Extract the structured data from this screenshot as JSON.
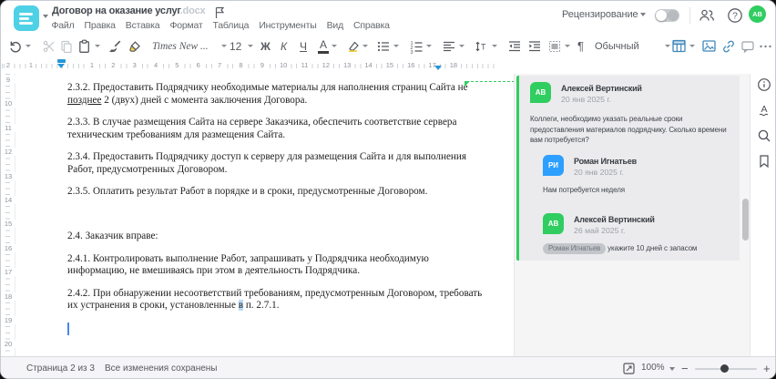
{
  "window": {
    "title": "Договор на оказание услуг",
    "title_ext": ".docx",
    "menus": [
      "Файл",
      "Правка",
      "Вставка",
      "Формат",
      "Таблица",
      "Инструменты",
      "Вид",
      "Справка"
    ],
    "review_label": "Рецензирование",
    "avatar_initials": "АВ"
  },
  "toolbar": {
    "font_name": "Times New ...",
    "font_size": "12",
    "bold_label": "Ж",
    "italic_label": "К",
    "underline_label": "Ч",
    "font_color_label": "А",
    "paragraph_mark": "¶",
    "style_name": "Обычный"
  },
  "ruler": {
    "h_left_numbers": [
      "2",
      "1"
    ],
    "h_numbers": [
      "1",
      "2",
      "3",
      "4",
      "5",
      "6",
      "7",
      "8",
      "9",
      "10",
      "11",
      "12",
      "13",
      "14",
      "15",
      "16",
      "17",
      "18"
    ],
    "v_numbers": [
      "9",
      "10",
      "11",
      "12",
      "13",
      "14",
      "15",
      "16",
      "17",
      "18",
      "19",
      "20"
    ]
  },
  "document": {
    "paragraphs": [
      {
        "runs": [
          {
            "t": "2.3.2. Предоставить Подрядчику необходимые материалы для наполнения страниц Сайта не\n"
          },
          {
            "t": "позднее",
            "u": true
          },
          {
            "t": " 2 (двух) дней с момента заключения Договора."
          }
        ]
      },
      {
        "runs": [
          {
            "t": "2.3.3. В случае размещения Сайта на сервере Заказчика, обеспечить соответствие сервера\nтехническим требованиям для размещения Сайта."
          }
        ]
      },
      {
        "runs": [
          {
            "t": "2.3.4. Предоставить Подрядчику доступ к серверу для размещения Сайта и для выполнения\nРабот, предусмотренных Договором."
          }
        ]
      },
      {
        "runs": [
          {
            "t": "2.3.5. Оплатить результат Работ в порядке и в сроки, предусмотренные Договором."
          }
        ]
      },
      {
        "empty": true,
        "runs": []
      },
      {
        "runs": [
          {
            "t": "2.4. Заказчик вправе:"
          }
        ]
      },
      {
        "runs": [
          {
            "t": "2.4.1. Контролировать выполнение Работ, запрашивать у Подрядчика необходимую\nинформацию, не вмешиваясь при этом в деятельность Подрядчика."
          }
        ]
      },
      {
        "runs": [
          {
            "t": "2.4.2. При обнаружении несоответствий требованиям, предусмотренным Договором, требовать\nих устранения в сроки, установленные "
          },
          {
            "t": "в",
            "hl": true
          },
          {
            "t": " п. 2.7.1."
          }
        ]
      }
    ]
  },
  "comments": [
    {
      "initials": "АВ",
      "color": "#30cd61",
      "name": "Алексей Вертинский",
      "date": "20 янв 2025 г.",
      "text": "Коллеги, необходимо указать реальные сроки\nпредоставления материалов подрядчику. Сколько времени\nвам потребуется?",
      "reply": false
    },
    {
      "initials": "РИ",
      "color": "#2d9fff",
      "name": "Роман Игнатьев",
      "date": "20 янв 2025 г.",
      "text": "Нам потребуется неделя",
      "reply": true
    },
    {
      "initials": "АВ",
      "color": "#30cd61",
      "name": "Алексей Вертинский",
      "date": "26 май 2025 г.",
      "mention": "Роман Игнатьев",
      "text": "укажите 10 дней с запасом",
      "reply": true
    }
  ],
  "statusbar": {
    "page_label": "Страница 2 из 3",
    "saved_label": "Все изменения сохранены",
    "zoom_value": "100%"
  }
}
